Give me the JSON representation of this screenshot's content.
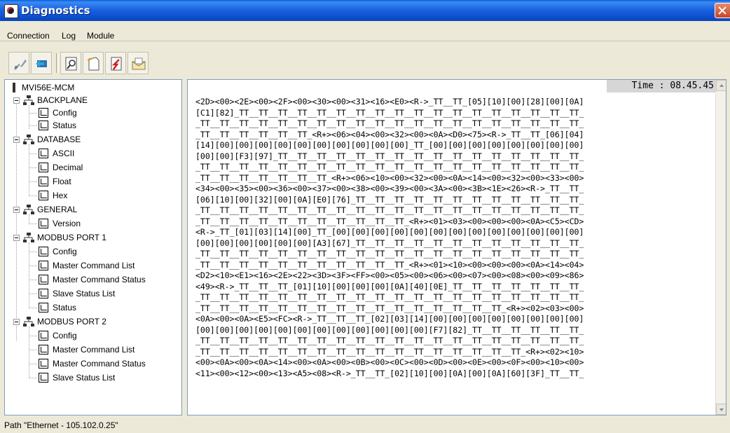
{
  "window": {
    "title": "Diagnostics"
  },
  "menu": [
    "Connection",
    "Log",
    "Module"
  ],
  "toolbar": {
    "buttons": [
      "connect-icon",
      "comm-icon",
      "search-icon",
      "new-doc-icon",
      "transfer-icon",
      "email-icon"
    ]
  },
  "tree": {
    "root": "MVI56E-MCM",
    "nodes": [
      {
        "label": "BACKPLANE",
        "children": [
          "Config",
          "Status"
        ]
      },
      {
        "label": "DATABASE",
        "children": [
          "ASCII",
          "Decimal",
          "Float",
          "Hex"
        ]
      },
      {
        "label": "GENERAL",
        "children": [
          "Version"
        ]
      },
      {
        "label": "MODBUS PORT 1",
        "children": [
          "Config",
          "Master Command List",
          "Master Command Status",
          "Slave Status List",
          "Status"
        ]
      },
      {
        "label": "MODBUS PORT 2",
        "children": [
          "Config",
          "Master Command List",
          "Master Command Status",
          "Slave Status List"
        ]
      }
    ]
  },
  "log": {
    "time": "Time : 08.45.45",
    "lines": [
      "<2D><00><2E><00><2F><00><30><00><31><16><E0><R->_TT__TT_[05][10][00][28][00][0A]",
      "[C1][82]_TT__TT__TT__TT__TT__TT__TT__TT__TT__TT__TT__TT__TT__TT__TT__TT__TT__TT_",
      "_TT__TT__TT__TT__TT__TT__TT__TT__TT__TT__TT__TT__TT__TT__TT__TT__TT__TT__TT__TT_",
      "_TT__TT__TT__TT__TT__TT_<R+><06><04><00><32><00><0A><D0><75><R->_TT__TT_[06][04]",
      "[14][00][00][00][00][00][00][00][00][00][00]_TT_[00][00][00][00][00][00][00][00]",
      "[00][00][F3][97]_TT__TT__TT__TT__TT__TT__TT__TT__TT__TT__TT__TT__TT__TT__TT__TT_",
      "_TT__TT__TT__TT__TT__TT__TT__TT__TT__TT__TT__TT__TT__TT__TT__TT__TT__TT__TT__TT_",
      "_TT__TT__TT__TT__TT__TT__TT_<R+><06><10><00><32><00><0A><14><00><32><00><33><00>",
      "<34><00><35><00><36><00><37><00><38><00><39><00><3A><00><3B><1E><26><R->_TT__TT_",
      "[06][10][00][32][00][0A][E0][76]_TT__TT__TT__TT__TT__TT__TT__TT__TT__TT__TT__TT_",
      "_TT__TT__TT__TT__TT__TT__TT__TT__TT__TT__TT__TT__TT__TT__TT__TT__TT__TT__TT__TT_",
      "_TT__TT__TT__TT__TT__TT__TT__TT__TT__TT__TT_<R+><01><03><00><00><00><0A><C5><CD>",
      "<R->_TT_[01][03][14][00]_TT_[00][00][00][00][00][00][00][00][00][00][00][00][00]",
      "[00][00][00][00][00][00][A3][67]_TT__TT__TT__TT__TT__TT__TT__TT__TT__TT__TT__TT_",
      "_TT__TT__TT__TT__TT__TT__TT__TT__TT__TT__TT__TT__TT__TT__TT__TT__TT__TT__TT__TT_",
      "_TT__TT__TT__TT__TT__TT__TT__TT__TT__TT__TT_<R+><01><10><00><00><00><0A><14><04>",
      "<D2><10><E1><16><2E><22><3D><3F><FF><00><05><00><06><00><07><00><08><00><09><86>",
      "<49><R->_TT__TT__TT_[01][10][00][00][00][0A][40][0E]_TT__TT__TT__TT__TT__TT__TT_",
      "_TT__TT__TT__TT__TT__TT__TT__TT__TT__TT__TT__TT__TT__TT__TT__TT__TT__TT__TT__TT_",
      "_TT__TT__TT__TT__TT__TT__TT__TT__TT__TT__TT__TT__TT__TT__TT__TT_<R+><02><03><00>",
      "<0A><00><0A><E5><FC><R->_TT__TT__TT_[02][03][14][00][00][00][00][00][00][00][00]",
      "[00][00][00][00][00][00][00][00][00][00][00][00][F7][82]_TT__TT__TT__TT__TT__TT_",
      "_TT__TT__TT__TT__TT__TT__TT__TT__TT__TT__TT__TT__TT__TT__TT__TT__TT__TT__TT__TT_",
      "_TT__TT__TT__TT__TT__TT__TT__TT__TT__TT__TT__TT__TT__TT__TT__TT__TT_<R+><02><10>",
      "<00><0A><00><0A><14><00><0A><00><0B><00><0C><00><0D><00><0E><00><0F><00><10><00>",
      "<11><00><12><00><13><A5><08><R->_TT__TT_[02][10][00][0A][00][0A][60][3F]_TT__TT_"
    ]
  },
  "status": {
    "path": "Path \"Ethernet - 105.102.0.25\""
  }
}
